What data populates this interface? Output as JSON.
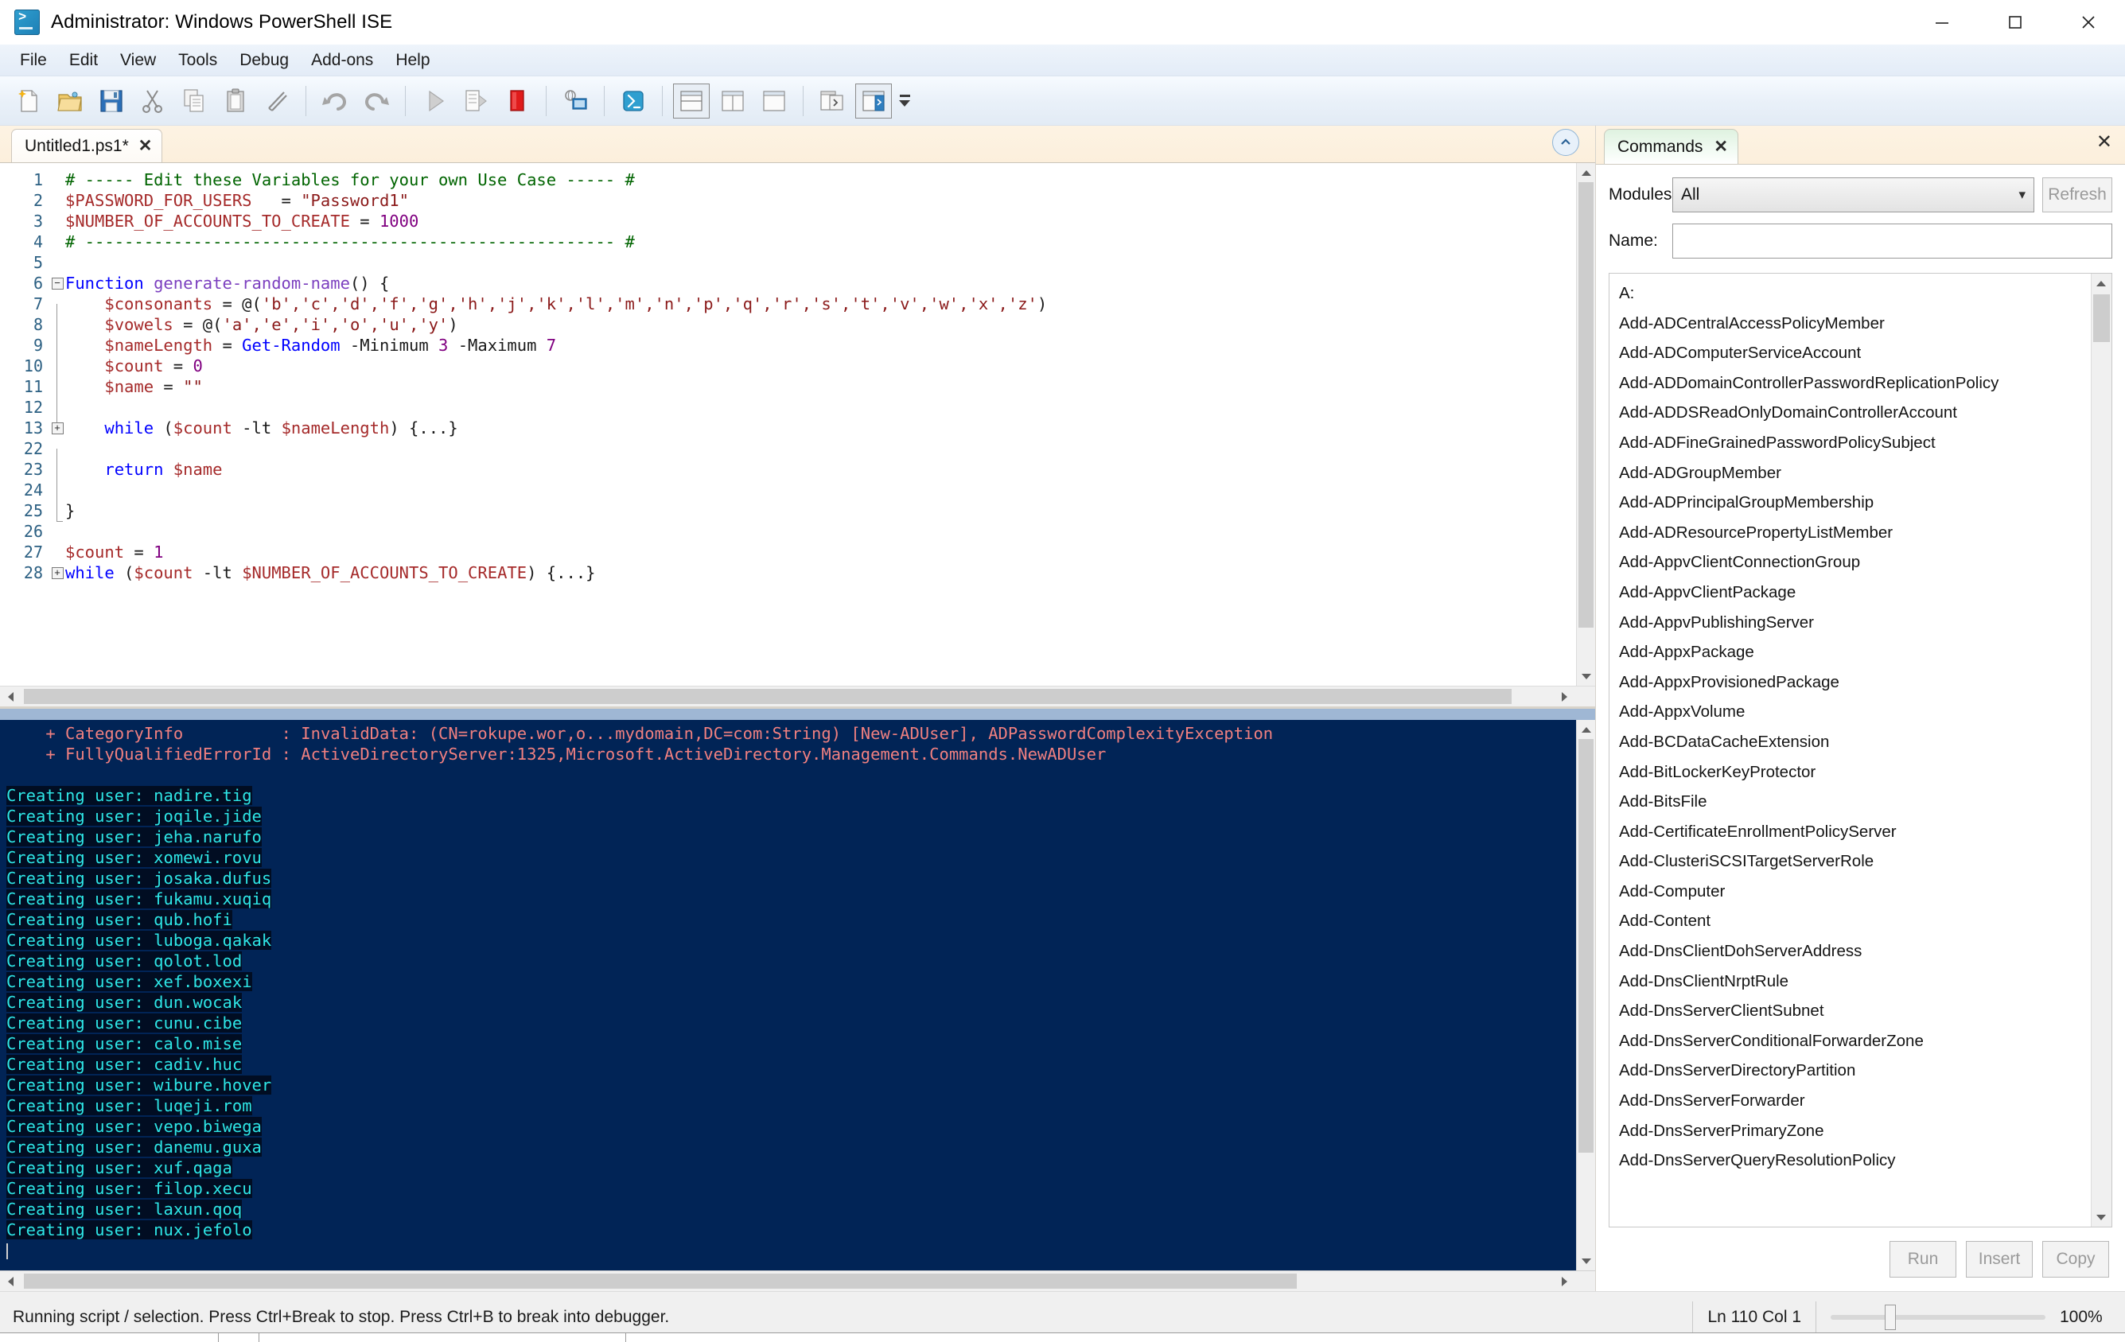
{
  "window": {
    "title": "Administrator: Windows PowerShell ISE",
    "app_icon": "powershell-icon",
    "minimize": "minimize-icon",
    "maximize": "maximize-icon",
    "close": "close-icon"
  },
  "menubar": {
    "items": [
      {
        "label": "File"
      },
      {
        "label": "Edit"
      },
      {
        "label": "View"
      },
      {
        "label": "Tools"
      },
      {
        "label": "Debug"
      },
      {
        "label": "Add-ons"
      },
      {
        "label": "Help"
      }
    ]
  },
  "toolbar": {
    "buttons": [
      {
        "name": "new-script-icon"
      },
      {
        "name": "open-script-icon"
      },
      {
        "name": "save-icon"
      },
      {
        "name": "cut-icon"
      },
      {
        "name": "copy-icon"
      },
      {
        "name": "paste-icon"
      },
      {
        "name": "clear-console-icon"
      },
      {
        "name": "undo-icon"
      },
      {
        "name": "redo-icon"
      },
      {
        "name": "run-script-icon"
      },
      {
        "name": "run-selection-icon"
      },
      {
        "name": "stop-operation-icon"
      },
      {
        "name": "new-remote-powershell-tab-icon"
      },
      {
        "name": "start-powershell-icon"
      },
      {
        "name": "show-script-pane-top-icon"
      },
      {
        "name": "show-script-pane-right-icon"
      },
      {
        "name": "show-script-pane-maximized-icon"
      },
      {
        "name": "show-command-pane-icon"
      },
      {
        "name": "show-commands-addon-icon"
      }
    ],
    "overflow_label": "toolbar-overflow-icon"
  },
  "editor": {
    "tab": {
      "label": "Untitled1.ps1*",
      "close": "✕"
    },
    "collapse_button": "collapse-script-pane-icon",
    "lines": [
      {
        "num": "1",
        "fold": "",
        "indent": 0,
        "tokens": [
          {
            "t": "# ----- Edit these Variables for your own Use Case ----- #",
            "c": "k-comment"
          }
        ]
      },
      {
        "num": "2",
        "fold": "",
        "indent": 0,
        "tokens": [
          {
            "t": "$PASSWORD_FOR_USERS",
            "c": "k-var"
          },
          {
            "t": "   = ",
            "c": "k-op"
          },
          {
            "t": "\"Password1\"",
            "c": "k-str"
          }
        ]
      },
      {
        "num": "3",
        "fold": "",
        "indent": 0,
        "tokens": [
          {
            "t": "$NUMBER_OF_ACCOUNTS_TO_CREATE",
            "c": "k-var"
          },
          {
            "t": " = ",
            "c": "k-op"
          },
          {
            "t": "1000",
            "c": "k-num"
          }
        ]
      },
      {
        "num": "4",
        "fold": "",
        "indent": 0,
        "tokens": [
          {
            "t": "# ------------------------------------------------------ #",
            "c": "k-comment"
          }
        ]
      },
      {
        "num": "5",
        "fold": "",
        "indent": 0,
        "tokens": []
      },
      {
        "num": "6",
        "fold": "minus",
        "indent": 0,
        "tokens": [
          {
            "t": "Function",
            "c": "k-kw"
          },
          {
            "t": " ",
            "c": "k-op"
          },
          {
            "t": "generate-random-name",
            "c": "k-fn"
          },
          {
            "t": "() {",
            "c": "k-op"
          }
        ]
      },
      {
        "num": "7",
        "fold": "bar",
        "indent": 1,
        "tokens": [
          {
            "t": "$consonants",
            "c": "k-var"
          },
          {
            "t": " = @(",
            "c": "k-op"
          },
          {
            "t": "'b','c','d','f','g','h','j','k','l','m','n','p','q','r','s','t','v','w','x','z'",
            "c": "k-str"
          },
          {
            "t": ")",
            "c": "k-op"
          }
        ]
      },
      {
        "num": "8",
        "fold": "bar",
        "indent": 1,
        "tokens": [
          {
            "t": "$vowels",
            "c": "k-var"
          },
          {
            "t": " = @(",
            "c": "k-op"
          },
          {
            "t": "'a','e','i','o','u','y'",
            "c": "k-str"
          },
          {
            "t": ")",
            "c": "k-op"
          }
        ]
      },
      {
        "num": "9",
        "fold": "bar",
        "indent": 1,
        "tokens": [
          {
            "t": "$nameLength",
            "c": "k-var"
          },
          {
            "t": " = ",
            "c": "k-op"
          },
          {
            "t": "Get-Random",
            "c": "k-cmd"
          },
          {
            "t": " -Minimum ",
            "c": "k-op"
          },
          {
            "t": "3",
            "c": "k-num"
          },
          {
            "t": " -Maximum ",
            "c": "k-op"
          },
          {
            "t": "7",
            "c": "k-num"
          }
        ]
      },
      {
        "num": "10",
        "fold": "bar",
        "indent": 1,
        "tokens": [
          {
            "t": "$count",
            "c": "k-var"
          },
          {
            "t": " = ",
            "c": "k-op"
          },
          {
            "t": "0",
            "c": "k-num"
          }
        ]
      },
      {
        "num": "11",
        "fold": "bar",
        "indent": 1,
        "tokens": [
          {
            "t": "$name",
            "c": "k-var"
          },
          {
            "t": " = ",
            "c": "k-op"
          },
          {
            "t": "\"\"",
            "c": "k-str"
          }
        ]
      },
      {
        "num": "12",
        "fold": "bar",
        "indent": 1,
        "tokens": []
      },
      {
        "num": "13",
        "fold": "plus",
        "indent": 1,
        "tokens": [
          {
            "t": "while",
            "c": "k-kw"
          },
          {
            "t": " (",
            "c": "k-op"
          },
          {
            "t": "$count",
            "c": "k-var"
          },
          {
            "t": " -lt ",
            "c": "k-op"
          },
          {
            "t": "$nameLength",
            "c": "k-var"
          },
          {
            "t": ") {...}",
            "c": "k-op"
          }
        ]
      },
      {
        "num": "22",
        "fold": "bar",
        "indent": 1,
        "tokens": []
      },
      {
        "num": "23",
        "fold": "bar",
        "indent": 1,
        "tokens": [
          {
            "t": "return",
            "c": "k-kw"
          },
          {
            "t": " ",
            "c": "k-op"
          },
          {
            "t": "$name",
            "c": "k-var"
          }
        ]
      },
      {
        "num": "24",
        "fold": "bar",
        "indent": 1,
        "tokens": []
      },
      {
        "num": "25",
        "fold": "endcap",
        "indent": 0,
        "tokens": [
          {
            "t": "}",
            "c": "k-op"
          }
        ]
      },
      {
        "num": "26",
        "fold": "",
        "indent": 0,
        "tokens": []
      },
      {
        "num": "27",
        "fold": "",
        "indent": 0,
        "tokens": [
          {
            "t": "$count",
            "c": "k-var"
          },
          {
            "t": " = ",
            "c": "k-op"
          },
          {
            "t": "1",
            "c": "k-num"
          }
        ]
      },
      {
        "num": "28",
        "fold": "plus0",
        "indent": 0,
        "tokens": [
          {
            "t": "while",
            "c": "k-kw"
          },
          {
            "t": " (",
            "c": "k-op"
          },
          {
            "t": "$count",
            "c": "k-var"
          },
          {
            "t": " -lt ",
            "c": "k-op"
          },
          {
            "t": "$NUMBER_OF_ACCOUNTS_TO_CREATE",
            "c": "k-var"
          },
          {
            "t": ") {...}",
            "c": "k-op"
          }
        ]
      }
    ]
  },
  "console": {
    "error_lines": [
      "    + CategoryInfo          : InvalidData: (CN=rokupe.wor,o...mydomain,DC=com:String) [New-ADUser], ADPasswordComplexityException",
      "    + FullyQualifiedErrorId : ActiveDirectoryServer:1325,Microsoft.ActiveDirectory.Management.Commands.NewADUser"
    ],
    "creating_prefix": "Creating user: ",
    "users": [
      "nadire.tig",
      "joqile.jide",
      "jeha.narufo",
      "xomewi.rovu",
      "josaka.dufus",
      "fukamu.xuqiq",
      "qub.hofi",
      "luboga.qakak",
      "qolot.lod",
      "xef.boxexi",
      "dun.wocak",
      "cunu.cibe",
      "calo.mise",
      "cadiv.huc",
      "wibure.hover",
      "luqeji.rom",
      "vepo.biwega",
      "danemu.guxa",
      "xuf.qaga",
      "filop.xecu",
      "laxun.qoq",
      "nux.jefolo"
    ]
  },
  "commands_pane": {
    "tab_label": "Commands",
    "tab_close": "✕",
    "pane_close": "✕",
    "modules_label": "Modules:",
    "modules_value": "All",
    "modules_chevron": "chevron-down-icon",
    "refresh_label": "Refresh",
    "name_label": "Name:",
    "name_value": "",
    "name_placeholder": "",
    "group_header": "A:",
    "items": [
      "Add-ADCentralAccessPolicyMember",
      "Add-ADComputerServiceAccount",
      "Add-ADDomainControllerPasswordReplicationPolicy",
      "Add-ADDSReadOnlyDomainControllerAccount",
      "Add-ADFineGrainedPasswordPolicySubject",
      "Add-ADGroupMember",
      "Add-ADPrincipalGroupMembership",
      "Add-ADResourcePropertyListMember",
      "Add-AppvClientConnectionGroup",
      "Add-AppvClientPackage",
      "Add-AppvPublishingServer",
      "Add-AppxPackage",
      "Add-AppxProvisionedPackage",
      "Add-AppxVolume",
      "Add-BCDataCacheExtension",
      "Add-BitLockerKeyProtector",
      "Add-BitsFile",
      "Add-CertificateEnrollmentPolicyServer",
      "Add-ClusteriSCSITargetServerRole",
      "Add-Computer",
      "Add-Content",
      "Add-DnsClientDohServerAddress",
      "Add-DnsClientNrptRule",
      "Add-DnsServerClientSubnet",
      "Add-DnsServerConditionalForwarderZone",
      "Add-DnsServerDirectoryPartition",
      "Add-DnsServerForwarder",
      "Add-DnsServerPrimaryZone",
      "Add-DnsServerQueryResolutionPolicy"
    ],
    "buttons": [
      {
        "label": "Run"
      },
      {
        "label": "Insert"
      },
      {
        "label": "Copy"
      }
    ]
  },
  "statusbar": {
    "message": "Running script / selection.  Press Ctrl+Break to stop.  Press Ctrl+B to break into debugger.",
    "line_col": "Ln 110  Col 1",
    "zoom": "100%"
  },
  "colors": {
    "console_background": "#012456",
    "console_error_text": "#f08080",
    "console_info_text": "#2ee6e6",
    "comment_green": "#006400",
    "variable_red": "#a52a2a",
    "keyword_blue": "#0000ff",
    "number_purple": "#800080",
    "accent_tab_green": "#dff2e0"
  }
}
